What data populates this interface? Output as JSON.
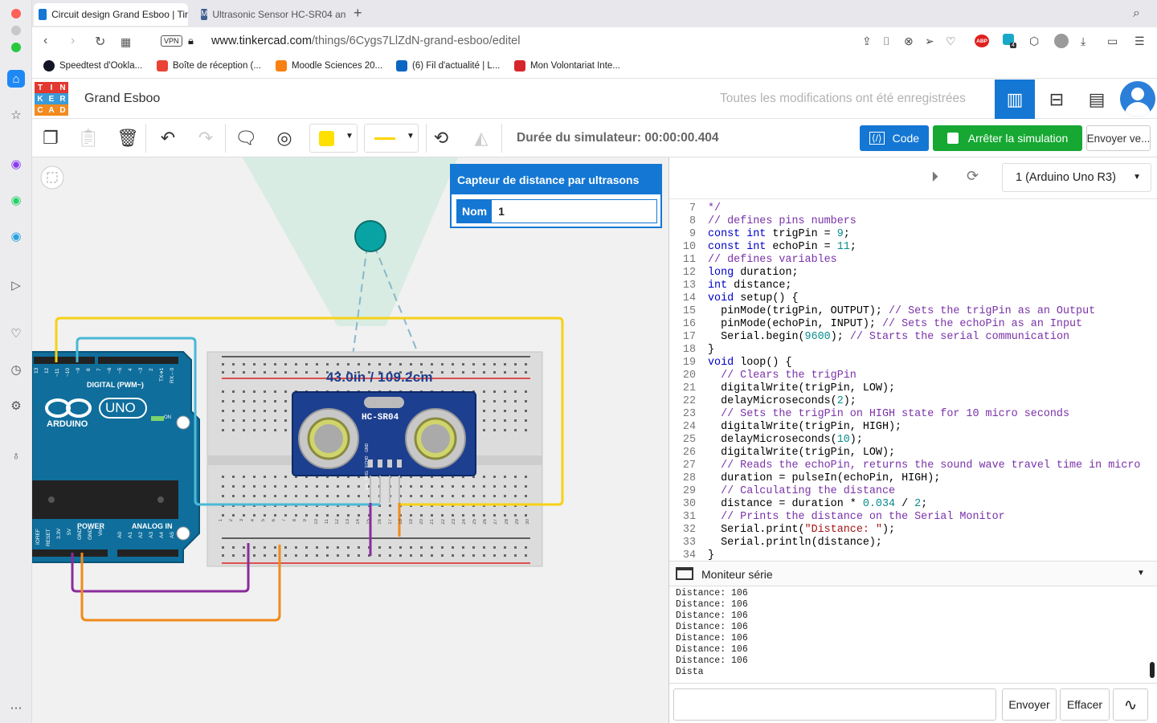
{
  "browser": {
    "tabs": [
      {
        "title": "Circuit design Grand Esboo | Tir",
        "active": true
      },
      {
        "title": "Ultrasonic Sensor HC-SR04 and",
        "active": false
      }
    ],
    "vpn_label": "VPN",
    "url_host": "www.tinkercad.com",
    "url_path": "/things/6Cygs7LlZdN-grand-esboo/editel",
    "ext_badge": "4",
    "abp_label": "ABP",
    "bookmarks": [
      {
        "label": "Speedtest d'Ookla...",
        "icon": "speedtest-icon",
        "color": "#141526"
      },
      {
        "label": "Boîte de réception (...",
        "icon": "gmail-icon",
        "color": "#ea4335"
      },
      {
        "label": "Moodle Sciences 20...",
        "icon": "moodle-icon",
        "color": "#f98012"
      },
      {
        "label": "(6) Fil d'actualité | L...",
        "icon": "linkedin-icon",
        "color": "#0a66c2"
      },
      {
        "label": "Mon Volontariat Inte...",
        "icon": "volontariat-icon",
        "color": "#d6262c"
      }
    ]
  },
  "tinkercad": {
    "logo_letters": [
      "T",
      "I",
      "N",
      "K",
      "E",
      "R",
      "C",
      "A",
      "D"
    ],
    "logo_colors": [
      "#e2382f",
      "#e2382f",
      "#e2382f",
      "#3b9bd6",
      "#3b9bd6",
      "#3b9bd6",
      "#f28b20",
      "#f28b20",
      "#f28b20"
    ],
    "project_name": "Grand Esboo",
    "save_status": "Toutes les modifications ont été enregistrées",
    "sim_time": "Durée du simulateur: 00:00:00.404",
    "code_button": "Code",
    "stop_button": "Arrêter la simulation",
    "send_button": "Envoyer ve...",
    "accent_blue": "#1477d4",
    "green": "#16a832",
    "color_swatch": "#ffe000"
  },
  "inspector": {
    "title": "Capteur de distance par ultrasons",
    "name_label": "Nom",
    "name_value": "1"
  },
  "canvas": {
    "distance_readout": "43.0in / 109.2cm",
    "sensor_label": "HC-SR04",
    "sensor_pins": [
      "Vcc",
      "TRIG",
      "ECHO",
      "GND"
    ],
    "arduino_brand": "ARDUINO",
    "arduino_model": "UNO",
    "arduino_digital": "DIGITAL (PWM~)",
    "arduino_power": "POWER",
    "arduino_analog": "ANALOG IN",
    "arduino_on": "ON",
    "arduino_txrx": [
      "TX➔1",
      "RX←0"
    ],
    "arduino_pins_top": [
      "13",
      "12",
      "~11",
      "~10",
      "~9",
      "8",
      "7",
      "~6",
      "~5",
      "4",
      "~3",
      "2"
    ],
    "arduino_pins_bottom_power": [
      "IOREF",
      "RESET",
      "3.3V",
      "5V",
      "GND",
      "GND",
      "Vin"
    ],
    "arduino_pins_analog": [
      "A0",
      "A1",
      "A2",
      "A3",
      "A4",
      "A5"
    ],
    "breadboard_rows": [
      "a",
      "b",
      "c",
      "d",
      "e",
      "f",
      "g",
      "h",
      "i",
      "j"
    ],
    "breadboard_cols_top": [
      "1",
      "2",
      "3",
      "4",
      "5",
      "6",
      "25",
      "26",
      "27",
      "28",
      "29",
      "30"
    ],
    "breadboard_cols_bottom": [
      "1",
      "2",
      "3",
      "4",
      "5",
      "6",
      "7",
      "8",
      "9",
      "10",
      "11",
      "12",
      "13",
      "14",
      "15",
      "16",
      "17",
      "18",
      "19",
      "20",
      "21",
      "22",
      "23",
      "24",
      "25",
      "26",
      "27",
      "28",
      "29",
      "30"
    ]
  },
  "code_panel": {
    "device": "1 (Arduino Uno R3)",
    "lines": [
      {
        "n": "7",
        "tokens": [
          [
            "cm",
            "*/"
          ]
        ]
      },
      {
        "n": "8",
        "tokens": [
          [
            "cm",
            "// defines pins numbers"
          ]
        ]
      },
      {
        "n": "9",
        "tokens": [
          [
            "kw",
            "const int"
          ],
          [
            "tx",
            " trigPin = "
          ],
          [
            "nm",
            "9"
          ],
          [
            "tx",
            ";"
          ]
        ]
      },
      {
        "n": "10",
        "tokens": [
          [
            "kw",
            "const int"
          ],
          [
            "tx",
            " echoPin = "
          ],
          [
            "nm",
            "11"
          ],
          [
            "tx",
            ";"
          ]
        ]
      },
      {
        "n": "11",
        "tokens": [
          [
            "cm",
            "// defines variables"
          ]
        ]
      },
      {
        "n": "12",
        "tokens": [
          [
            "kw",
            "long"
          ],
          [
            "tx",
            " duration;"
          ]
        ]
      },
      {
        "n": "13",
        "tokens": [
          [
            "kw",
            "int"
          ],
          [
            "tx",
            " distance;"
          ]
        ]
      },
      {
        "n": "14",
        "tokens": [
          [
            "kw",
            "void"
          ],
          [
            "tx",
            " setup() {"
          ]
        ]
      },
      {
        "n": "15",
        "tokens": [
          [
            "tx",
            "  pinMode(trigPin, OUTPUT); "
          ],
          [
            "cm",
            "// Sets the trigPin as an Output"
          ]
        ]
      },
      {
        "n": "16",
        "tokens": [
          [
            "tx",
            "  pinMode(echoPin, INPUT); "
          ],
          [
            "cm",
            "// Sets the echoPin as an Input"
          ]
        ]
      },
      {
        "n": "17",
        "tokens": [
          [
            "tx",
            "  Serial.begin("
          ],
          [
            "nm",
            "9600"
          ],
          [
            "tx",
            "); "
          ],
          [
            "cm",
            "// Starts the serial communication"
          ]
        ]
      },
      {
        "n": "18",
        "tokens": [
          [
            "tx",
            "}"
          ]
        ]
      },
      {
        "n": "19",
        "tokens": [
          [
            "kw",
            "void"
          ],
          [
            "tx",
            " loop() {"
          ]
        ]
      },
      {
        "n": "20",
        "tokens": [
          [
            "cm",
            "  // Clears the trigPin"
          ]
        ]
      },
      {
        "n": "21",
        "tokens": [
          [
            "tx",
            "  digitalWrite(trigPin, LOW);"
          ]
        ]
      },
      {
        "n": "22",
        "tokens": [
          [
            "tx",
            "  delayMicroseconds("
          ],
          [
            "nm",
            "2"
          ],
          [
            "tx",
            ");"
          ]
        ]
      },
      {
        "n": "23",
        "tokens": [
          [
            "cm",
            "  // Sets the trigPin on HIGH state for 10 micro seconds"
          ]
        ]
      },
      {
        "n": "24",
        "tokens": [
          [
            "tx",
            "  digitalWrite(trigPin, HIGH);"
          ]
        ]
      },
      {
        "n": "25",
        "tokens": [
          [
            "tx",
            "  delayMicroseconds("
          ],
          [
            "nm",
            "10"
          ],
          [
            "tx",
            ");"
          ]
        ]
      },
      {
        "n": "26",
        "tokens": [
          [
            "tx",
            "  digitalWrite(trigPin, LOW);"
          ]
        ]
      },
      {
        "n": "27",
        "tokens": [
          [
            "cm",
            "  // Reads the echoPin, returns the sound wave travel time in micro"
          ]
        ]
      },
      {
        "n": "28",
        "tokens": [
          [
            "tx",
            "  duration = pulseIn(echoPin, HIGH);"
          ]
        ]
      },
      {
        "n": "29",
        "tokens": [
          [
            "cm",
            "  // Calculating the distance"
          ]
        ]
      },
      {
        "n": "30",
        "tokens": [
          [
            "tx",
            "  distance = duration * "
          ],
          [
            "nm",
            "0.034"
          ],
          [
            "tx",
            " / "
          ],
          [
            "nm",
            "2"
          ],
          [
            "tx",
            ";"
          ]
        ]
      },
      {
        "n": "31",
        "tokens": [
          [
            "cm",
            "  // Prints the distance on the Serial Monitor"
          ]
        ]
      },
      {
        "n": "32",
        "tokens": [
          [
            "tx",
            "  Serial.print("
          ],
          [
            "st",
            "\"Distance: \""
          ],
          [
            "tx",
            ");"
          ]
        ]
      },
      {
        "n": "33",
        "tokens": [
          [
            "tx",
            "  Serial.println(distance);"
          ]
        ]
      },
      {
        "n": "34",
        "tokens": [
          [
            "tx",
            "}"
          ]
        ]
      }
    ],
    "serial_title": "Moniteur série",
    "serial_output": [
      "Distance: 106",
      "Distance: 106",
      "Distance: 106",
      "Distance: 106",
      "Distance: 106",
      "Distance: 106",
      "Distance: 106",
      "Dista"
    ],
    "serial_input_placeholder": "",
    "send_label": "Envoyer",
    "clear_label": "Effacer"
  }
}
